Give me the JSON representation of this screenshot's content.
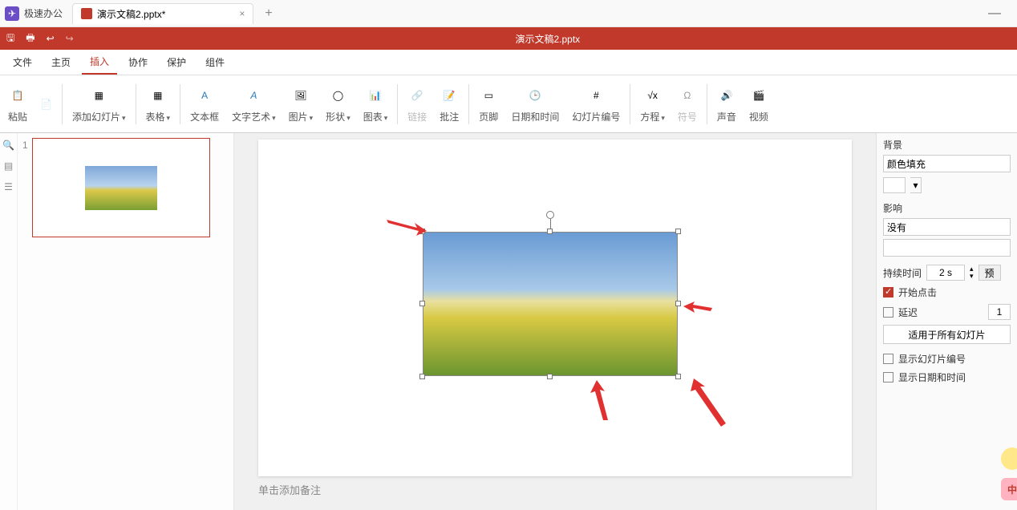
{
  "app": {
    "name": "极速办公"
  },
  "tab": {
    "title": "演示文稿2.pptx*",
    "add": "+",
    "close": "×"
  },
  "window": {
    "minimize": "—",
    "doc_title": "演示文稿2.pptx"
  },
  "menu": {
    "file": "文件",
    "home": "主页",
    "insert": "插入",
    "collab": "协作",
    "protect": "保护",
    "addin": "组件"
  },
  "ribbon": {
    "paste": "粘贴",
    "add_slide": "添加幻灯片",
    "table": "表格",
    "textbox": "文本框",
    "wordart": "文字艺术",
    "image": "图片",
    "shape": "形状",
    "chart": "图表",
    "link": "链接",
    "comment": "批注",
    "footer": "页脚",
    "datetime": "日期和时间",
    "slidenum": "幻灯片编号",
    "equation": "方程",
    "symbol": "符号",
    "audio": "声音",
    "video": "视频"
  },
  "thumb": {
    "num": "1"
  },
  "notes": {
    "placeholder": "单击添加备注"
  },
  "panel": {
    "bg": "背景",
    "color_fill": "颜色填充",
    "effect": "影响",
    "none": "没有",
    "duration": "持续时间",
    "duration_val": "2 s",
    "preview": "预",
    "start_click": "开始点击",
    "delay": "延迟",
    "delay_val": "1",
    "apply_all": "适用于所有幻灯片",
    "show_num": "显示幻灯片编号",
    "show_dt": "显示日期和时间"
  },
  "ime": "中"
}
